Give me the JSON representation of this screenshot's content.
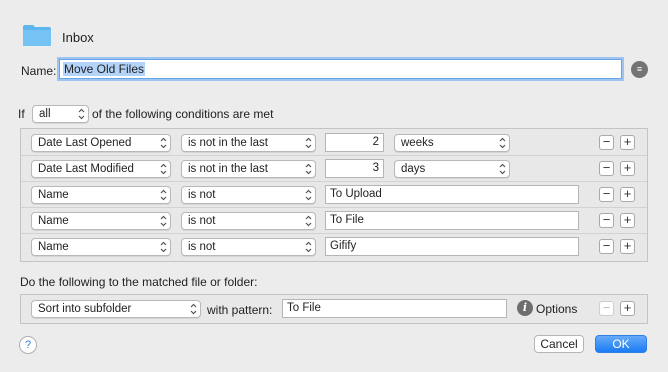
{
  "header": {
    "folder_name": "Inbox"
  },
  "name": {
    "label": "Name:",
    "value": "Move Old Files"
  },
  "conditions": {
    "if_label": "If",
    "match_value": "all",
    "suffix": "of the following conditions are met",
    "rows": [
      {
        "attribute": "Date Last Opened",
        "operator": "is not in the last",
        "value": "2",
        "unit": "weeks"
      },
      {
        "attribute": "Date Last Modified",
        "operator": "is not in the last",
        "value": "3",
        "unit": "days"
      },
      {
        "attribute": "Name",
        "operator": "is not",
        "value": "To Upload"
      },
      {
        "attribute": "Name",
        "operator": "is not",
        "value": "To File"
      },
      {
        "attribute": "Name",
        "operator": "is not",
        "value": "Gifify"
      }
    ]
  },
  "action": {
    "label": "Do the following to the matched file or folder:",
    "type": "Sort into subfolder",
    "with_label": "with pattern:",
    "pattern": "To File",
    "options_label": "Options"
  },
  "footer": {
    "help": "?",
    "cancel": "Cancel",
    "ok": "OK"
  },
  "icons": {
    "plus": "+",
    "minus": "−"
  },
  "colors": {
    "accent": "#1a7cf4",
    "folder": "#5fb6ef"
  }
}
